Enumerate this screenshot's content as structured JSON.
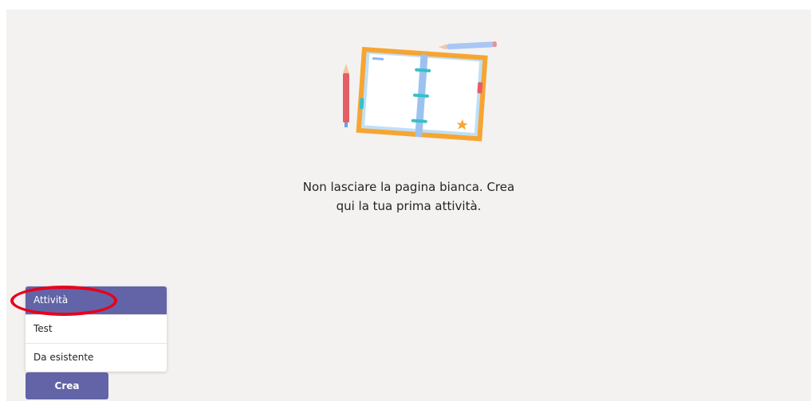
{
  "empty_state": {
    "line1": "Non lasciare la pagina bianca. Crea",
    "line2": "qui la tua prima attività.",
    "illustration_icon": "notebook-illustration-icon"
  },
  "create_menu": {
    "items": [
      {
        "label": "Attività",
        "active": true
      },
      {
        "label": "Test",
        "active": false
      },
      {
        "label": "Da esistente",
        "active": false
      }
    ]
  },
  "create_button": {
    "label": "Crea"
  },
  "colors": {
    "accent": "#6264a7",
    "background": "#f3f2f1",
    "annotation": "#e8001c"
  }
}
